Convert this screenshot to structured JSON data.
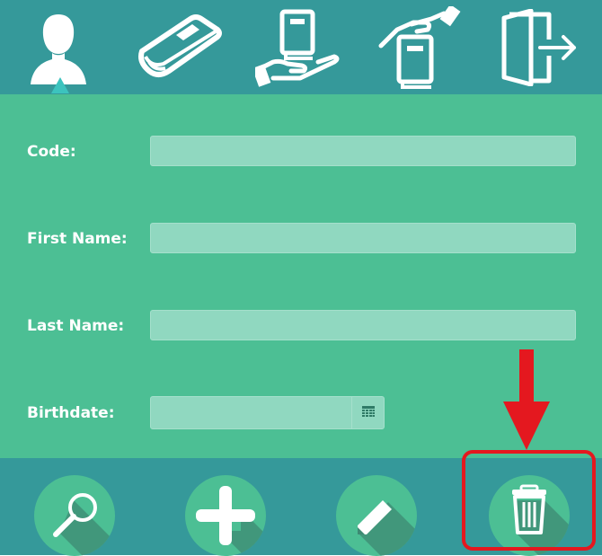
{
  "nav": {
    "items": [
      {
        "id": "users",
        "icon": "user-icon",
        "active": true
      },
      {
        "id": "books",
        "icon": "book-icon",
        "active": false
      },
      {
        "id": "borrow",
        "icon": "hand-receive-book-icon",
        "active": false
      },
      {
        "id": "return",
        "icon": "give-book-icon",
        "active": false
      },
      {
        "id": "logout",
        "icon": "exit-door-icon",
        "active": false
      }
    ]
  },
  "form": {
    "code_label": "Code:",
    "code_value": "",
    "first_name_label": "First Name:",
    "first_name_value": "",
    "last_name_label": "Last Name:",
    "last_name_value": "",
    "birthdate_label": "Birthdate:",
    "birthdate_value": ""
  },
  "actions": [
    {
      "id": "search",
      "icon": "magnifier-icon"
    },
    {
      "id": "add",
      "icon": "plus-icon"
    },
    {
      "id": "edit",
      "icon": "pencil-icon"
    },
    {
      "id": "delete",
      "icon": "trash-icon",
      "highlighted": true
    }
  ],
  "colors": {
    "header_bg": "#35999a",
    "form_bg": "#4cbf94",
    "field_bg": "#90d8c0",
    "highlight": "#e4181f"
  }
}
